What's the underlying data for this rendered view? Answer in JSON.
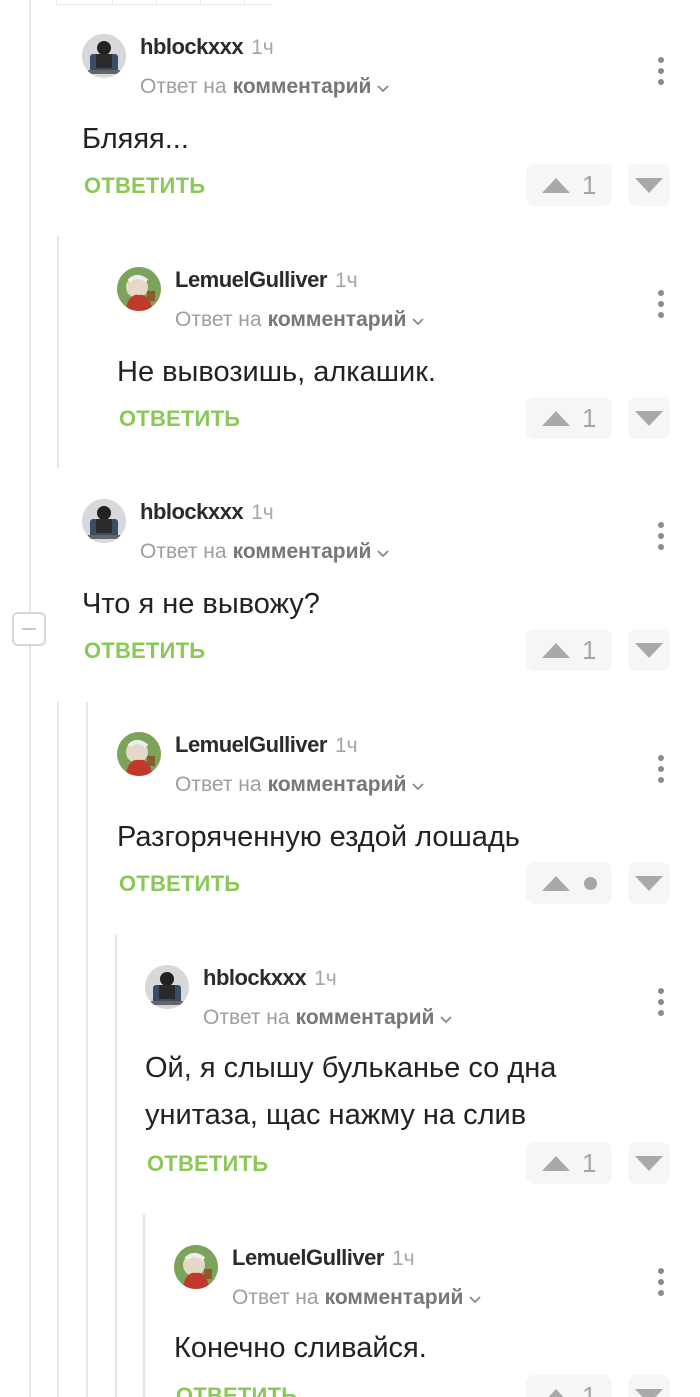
{
  "ui": {
    "reply_prefix": "Ответ на",
    "reply_target": "комментарий",
    "reply_button": "ОТВЕТИТЬ"
  },
  "comments": [
    {
      "author": "hblockxxx",
      "time": "1ч",
      "text": [
        "Бляяя..."
      ],
      "rating": "1"
    },
    {
      "author": "LemuelGulliver",
      "time": "1ч",
      "text": [
        "Не вывозишь, алкашик."
      ],
      "rating": "1"
    },
    {
      "author": "hblockxxx",
      "time": "1ч",
      "text": [
        "Что я не вывожу?"
      ],
      "rating": "1"
    },
    {
      "author": "LemuelGulliver",
      "time": "1ч",
      "text": [
        "Разгоряченную ездой лошадь"
      ],
      "rating": ""
    },
    {
      "author": "hblockxxx",
      "time": "1ч",
      "text": [
        "Ой, я слышу бульканье со дна",
        "унитаза, щас нажму на слив"
      ],
      "rating": "1"
    },
    {
      "author": "LemuelGulliver",
      "time": "1ч",
      "text": [
        "Конечно сливайся."
      ],
      "rating": "1"
    }
  ],
  "colors": {
    "reply_green": "#8ac858",
    "thread_line": "#e6e6e6",
    "vote_bg": "#f6f6f6"
  }
}
